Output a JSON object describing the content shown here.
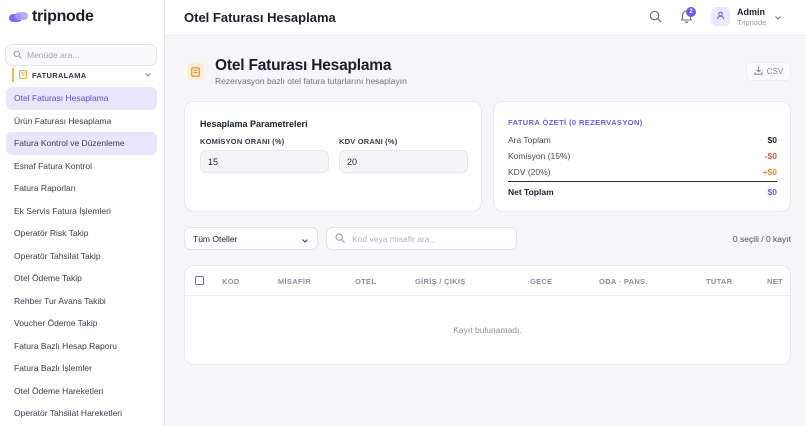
{
  "app": {
    "logo_text": "tripnode"
  },
  "sidebar": {
    "search_placeholder": "Menüde ara...",
    "section_label": "FATURALAMA",
    "items": [
      {
        "label": "Otel Faturası Hesaplama"
      },
      {
        "label": "Ürün Faturası Hesaplama"
      },
      {
        "label": "Fatura Kontrol ve Düzenleme"
      },
      {
        "label": "Esnaf Fatura Kontrol"
      },
      {
        "label": "Fatura Raporları"
      },
      {
        "label": "Ek Servis Fatura İşlemleri"
      },
      {
        "label": "Operatör Risk Takip"
      },
      {
        "label": "Operatör Tahsilat Takip"
      },
      {
        "label": "Otel Ödeme Takip"
      },
      {
        "label": "Rehber Tur Avans Takibi"
      },
      {
        "label": "Voucher Ödeme Takip"
      },
      {
        "label": "Fatura Bazlı Hesap Raporu"
      },
      {
        "label": "Fatura Bazlı İşlemler"
      },
      {
        "label": "Otel Ödeme Hareketleri"
      },
      {
        "label": "Operatör Tahsilat Hareketleri"
      }
    ]
  },
  "header": {
    "title": "Otel Faturası Hesaplama",
    "notification_count": "2",
    "user_name": "Admin",
    "user_org": "Tripnode"
  },
  "page": {
    "title": "Otel Faturası Hesaplama",
    "subtitle": "Rezervasyon bazlı otel fatura tutarlarını hesaplayın",
    "csv_label": "CSV"
  },
  "params": {
    "title": "Hesaplama Parametreleri",
    "commission_label": "KOMİSYON ORANI (%)",
    "commission_value": "15",
    "vat_label": "KDV ORANI (%)",
    "vat_value": "20"
  },
  "summary": {
    "title": "FATURA ÖZETİ (0 REZERVASYON)",
    "subtotal_label": "Ara Toplam",
    "subtotal_value": "$0",
    "commission_label": "Komisyon (15%)",
    "commission_value": "-$0",
    "vat_label": "KDV (20%)",
    "vat_value": "+$0",
    "net_label": "Net Toplam",
    "net_value": "$0"
  },
  "filters": {
    "hotel_select": "Tüm Oteller",
    "search_placeholder": "Kod veya misafir ara...",
    "selection_count": "0 seçili / 0 kayıt"
  },
  "table": {
    "columns": [
      "KOD",
      "MİSAFİR",
      "OTEL",
      "GİRİŞ / ÇIKIŞ",
      "GECE",
      "ODA · PANS.",
      "TUTAR",
      "NET"
    ],
    "empty_text": "Kayıt bulunamadı."
  },
  "colors": {
    "accent": "#6a5cf0",
    "active_bg": "#e9e6fb",
    "negative": "#e0564b",
    "positive": "#ee8d2a"
  },
  "icons": {
    "menu_search": "search-icon",
    "section": "invoice-icon",
    "notifications": "bell-icon",
    "user": "user-icon",
    "csv": "download-icon"
  }
}
